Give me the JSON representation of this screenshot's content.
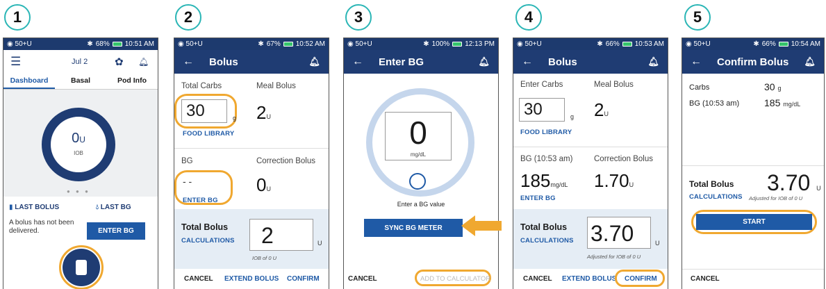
{
  "steps": [
    "1",
    "2",
    "3",
    "4",
    "5"
  ],
  "colors": {
    "navy": "#1f3c73",
    "accent_blue": "#1f5aa6",
    "highlight": "#f0a830",
    "step_ring": "#2bb6b6"
  },
  "screen1": {
    "status": {
      "left": "50+U",
      "battery": "68%",
      "time": "10:51 AM"
    },
    "date": "Jul 2",
    "tabs": [
      "Dashboard",
      "Basal",
      "Pod Info"
    ],
    "iob_value": "0",
    "iob_unit": "U",
    "iob_label": "IOB",
    "last_bolus_label": "LAST BOLUS",
    "last_bg_label": "LAST BG",
    "last_bolus_text": "A bolus has not been delivered.",
    "enter_bg_button": "ENTER BG"
  },
  "screen2": {
    "status": {
      "left": "50+U",
      "battery": "67%",
      "time": "10:52 AM"
    },
    "title": "Bolus",
    "total_carbs_label": "Total Carbs",
    "carbs_value": "30",
    "carbs_unit": "g",
    "meal_bolus_label": "Meal Bolus",
    "meal_bolus_value": "2",
    "meal_bolus_unit": "U",
    "food_library": "FOOD LIBRARY",
    "bg_label": "BG",
    "bg_value": "- -",
    "enter_bg": "ENTER BG",
    "correction_label": "Correction Bolus",
    "correction_value": "0",
    "correction_unit": "U",
    "total_bolus_label": "Total Bolus",
    "calculations": "CALCULATIONS",
    "total_value": "2",
    "total_unit": "U",
    "iob_note": "IOB of 0 U",
    "cancel": "CANCEL",
    "extend": "EXTEND BOLUS",
    "confirm": "CONFIRM"
  },
  "screen3": {
    "status": {
      "left": "50+U",
      "battery": "100%",
      "time": "12:13 PM"
    },
    "title": "Enter BG",
    "bg_value": "0",
    "bg_unit": "mg/dL",
    "prompt": "Enter a BG value",
    "sync_button": "SYNC BG METER",
    "cancel": "CANCEL",
    "add_to_calc": "ADD TO CALCULATOR"
  },
  "screen4": {
    "status": {
      "left": "50+U",
      "battery": "66%",
      "time": "10:53 AM"
    },
    "title": "Bolus",
    "enter_carbs_label": "Enter Carbs",
    "carbs_value": "30",
    "carbs_unit": "g",
    "meal_bolus_label": "Meal Bolus",
    "meal_bolus_value": "2",
    "meal_bolus_unit": "U",
    "food_library": "FOOD LIBRARY",
    "bg_label": "BG (10:53 am)",
    "bg_value": "185",
    "bg_unit": "mg/dL",
    "enter_bg": "ENTER BG",
    "correction_label": "Correction Bolus",
    "correction_value": "1.70",
    "correction_unit": "U",
    "total_bolus_label": "Total Bolus",
    "calculations": "CALCULATIONS",
    "total_value": "3.70",
    "total_unit": "U",
    "iob_note": "Adjusted for IOB of 0 U",
    "cancel": "CANCEL",
    "extend": "EXTEND BOLUS",
    "confirm": "CONFIRM"
  },
  "screen5": {
    "status": {
      "left": "50+U",
      "battery": "66%",
      "time": "10:54 AM"
    },
    "title": "Confirm Bolus",
    "carbs_label": "Carbs",
    "carbs_value": "30",
    "carbs_unit": "g",
    "bg_label": "BG (10:53 am)",
    "bg_value": "185",
    "bg_unit": "mg/dL",
    "total_bolus_label": "Total Bolus",
    "calculations": "CALCULATIONS",
    "total_value": "3.70",
    "total_unit": "U",
    "iob_note": "Adjusted for IOB of 0 U",
    "start_button": "START",
    "cancel": "CANCEL"
  }
}
